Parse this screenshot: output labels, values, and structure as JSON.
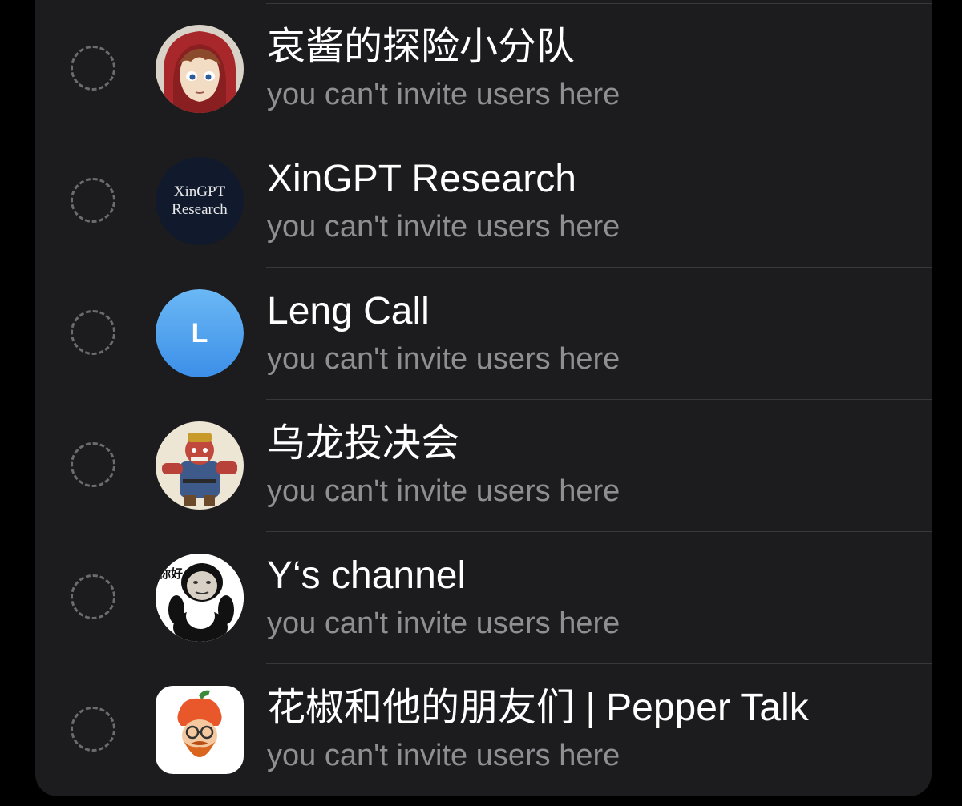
{
  "chat_list": {
    "items": [
      {
        "title": "哀酱的探险小分队",
        "subtitle": "you can't invite users here",
        "avatar_icon": "anime-girl-red-hood-avatar"
      },
      {
        "title": "XinGPT Research",
        "subtitle": "you can't invite users here",
        "avatar_icon": "text-logo-avatar",
        "avatar_text_line1": "XinGPT",
        "avatar_text_line2": "Research"
      },
      {
        "title": "Leng Call",
        "subtitle": "you can't invite users here",
        "avatar_icon": "letter-avatar",
        "avatar_letter": "L"
      },
      {
        "title": "乌龙投决会",
        "subtitle": "you can't invite users here",
        "avatar_icon": "comic-warrior-avatar"
      },
      {
        "title": "Y‘s channel",
        "subtitle": "you can't invite users here",
        "avatar_icon": "panda-meme-avatar",
        "avatar_caption": "你好"
      },
      {
        "title": "花椒和他的朋友们 | Pepper Talk",
        "subtitle": "you can't invite users here",
        "avatar_icon": "pepper-character-avatar"
      }
    ]
  },
  "colors": {
    "background": "#000000",
    "panel": "#1c1c1e",
    "title_text": "#ffffff",
    "subtitle_text": "#8e8e93",
    "divider": "#38383a",
    "select_circle": "#6b6b70",
    "letter_avatar_gradient_top": "#6bb8f5",
    "letter_avatar_gradient_bottom": "#3c8fe8"
  }
}
